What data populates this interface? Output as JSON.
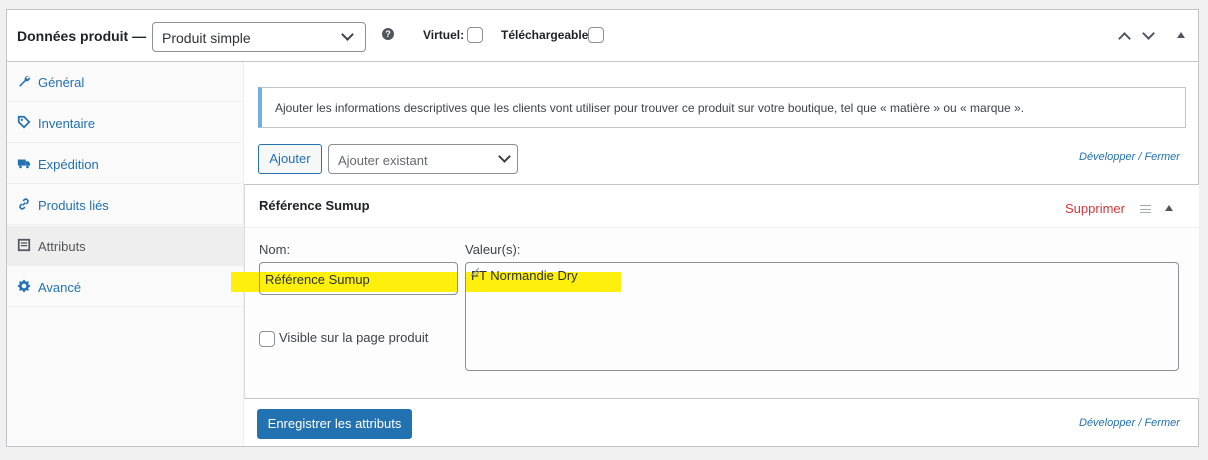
{
  "header": {
    "title": "Données produit —",
    "product_type": "Produit simple",
    "help_icon": "question-icon",
    "virtual_label": "Virtuel:",
    "virtual_checked": false,
    "downloadable_label": "Téléchargeable:",
    "downloadable_checked": false
  },
  "sidebar": {
    "items": [
      {
        "label": "Général",
        "icon": "wrench-icon",
        "active": false
      },
      {
        "label": "Inventaire",
        "icon": "tag-icon",
        "active": false
      },
      {
        "label": "Expédition",
        "icon": "truck-icon",
        "active": false
      },
      {
        "label": "Produits liés",
        "icon": "link-icon",
        "active": false
      },
      {
        "label": "Attributs",
        "icon": "list-view-icon",
        "active": true
      },
      {
        "label": "Avancé",
        "icon": "gear-icon",
        "active": false
      }
    ]
  },
  "main": {
    "notice": "Ajouter les informations descriptives que les clients vont utiliser pour trouver ce produit sur votre boutique, tel que « matière » ou « marque ».",
    "add_button": "Ajouter",
    "existing_placeholder": "Ajouter existant",
    "expand_top": "Développer",
    "separator_top": "/",
    "collapse_top": "Fermer",
    "attribute": {
      "title": "Référence Sumup",
      "remove_label": "Supprimer",
      "name_label": "Nom:",
      "name_value": "Référence Sumup",
      "values_label": "Valeur(s):",
      "values_value": "FT Normandie Dry",
      "visible_label": "Visible sur la page produit",
      "visible_checked": false
    },
    "save_button": "Enregistrer les attributs",
    "expand_bottom": "Développer",
    "separator_bottom": "/",
    "collapse_bottom": "Fermer"
  },
  "colors": {
    "accent": "#2271b1",
    "danger": "#d63638",
    "highlight": "#ffee00"
  }
}
